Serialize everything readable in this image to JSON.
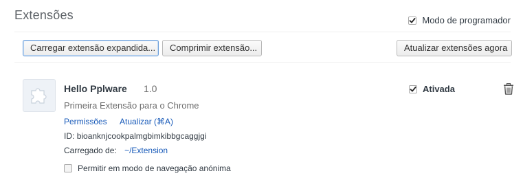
{
  "header": {
    "title": "Extensões",
    "developer_mode_label": "Modo de programador",
    "developer_mode_checked": true
  },
  "toolbar": {
    "load_unpacked_label": "Carregar extensão expandida...",
    "pack_label": "Comprimir extensão...",
    "update_label": "Atualizar extensões agora"
  },
  "extension": {
    "icon": "puzzle-piece-icon",
    "name": "Hello Pplware",
    "version": "1.0",
    "description": "Primeira Extensão para o Chrome",
    "permissions_link": "Permissões",
    "reload_link": "Atualizar (⌘A)",
    "id_label": "ID:",
    "id_value": "bioanknjcookpalmgbimkibbgcaggjgi",
    "loaded_from_label": "Carregado de:",
    "loaded_from_path": "~/Extension",
    "enabled_label": "Ativada",
    "enabled_checked": true,
    "delete_icon": "trash-icon",
    "incognito_label": "Permitir em modo de navegação anónima",
    "incognito_checked": false
  }
}
